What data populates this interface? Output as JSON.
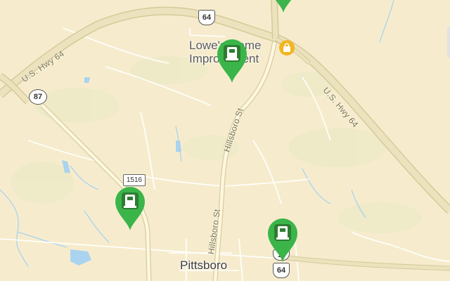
{
  "map": {
    "town": "Pittsboro",
    "poi": {
      "line1": "Lowe's Home",
      "line2": "Improvement"
    },
    "roads": {
      "us64_west": "U.S. Hwy 64",
      "us64_east": "U.S. Hwy 64",
      "hillsboro_north": "Hillsboro St",
      "hillsboro_south": "Hillsboro St"
    },
    "shields": {
      "us64_top": "64",
      "nc87": "87",
      "sr1516": "1516",
      "us15": "15",
      "us64_bottom": "64"
    },
    "pins": [
      {
        "name": "charging-station-pin",
        "icon": "ev-charger-icon"
      },
      {
        "name": "charging-station-pin",
        "icon": "ev-charger-icon"
      },
      {
        "name": "charging-station-pin",
        "icon": "ev-charger-icon"
      },
      {
        "name": "charging-station-pin",
        "icon": "ev-charger-icon"
      }
    ],
    "colors": {
      "land": "#f6eccd",
      "highway": "#ebe0ba",
      "highway_edge": "#d6c99a",
      "water": "#aad3ef",
      "green": "#e9e8c4",
      "pin": "#3bb54a",
      "pin_dark": "#2e7d32",
      "shopping_marker": "#f2b51f"
    }
  }
}
